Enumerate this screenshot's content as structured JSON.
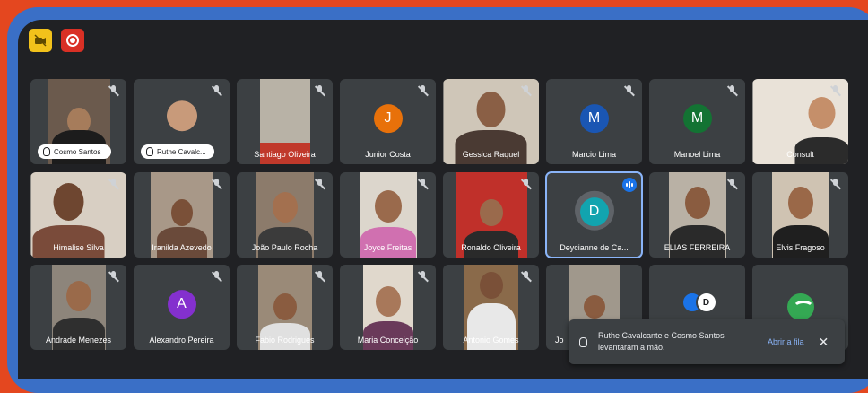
{
  "toolbar": {
    "camera_icon": "camera-off-icon",
    "record_icon": "record-icon"
  },
  "tiles": [
    {
      "name": "Cosmo Santos",
      "hand_raised": true
    },
    {
      "name": "Ruthe Cavalc...",
      "hand_raised": true
    },
    {
      "name": "Santiago Oliveira"
    },
    {
      "name": "Junior Costa",
      "initial": "J",
      "avatar_color": "#e8710a"
    },
    {
      "name": "Gessica Raquel"
    },
    {
      "name": "Marcio Lima",
      "initial": "M",
      "avatar_color": "#1a56b3"
    },
    {
      "name": "Manoel Lima",
      "initial": "M",
      "avatar_color": "#137333"
    },
    {
      "name": "Consult"
    },
    {
      "name": "Himalise Silva"
    },
    {
      "name": "Iranilda Azevedo"
    },
    {
      "name": "João Paulo Rocha"
    },
    {
      "name": "Joyce Freitas"
    },
    {
      "name": "Ronaldo Oliveira"
    },
    {
      "name": "Deycianne de Ca...",
      "initial": "D",
      "avatar_color": "#12a4af",
      "speaking": true
    },
    {
      "name": "ELIAS FERREIRA"
    },
    {
      "name": "Elvis Fragoso"
    },
    {
      "name": "Andrade Menezes"
    },
    {
      "name": "Alexandro Pereira",
      "initial": "A",
      "avatar_color": "#8430ce"
    },
    {
      "name": "Fabio Rodrigues"
    },
    {
      "name": "Maria Conceição"
    },
    {
      "name": "Antonio Gomes"
    },
    {
      "name": "Jo"
    },
    {
      "name": ""
    },
    {
      "name": ""
    }
  ],
  "toast": {
    "message": "Ruthe Cavalcante e Cosmo Santos levantaram a mão.",
    "action": "Abrir a fila",
    "close": "✕"
  }
}
